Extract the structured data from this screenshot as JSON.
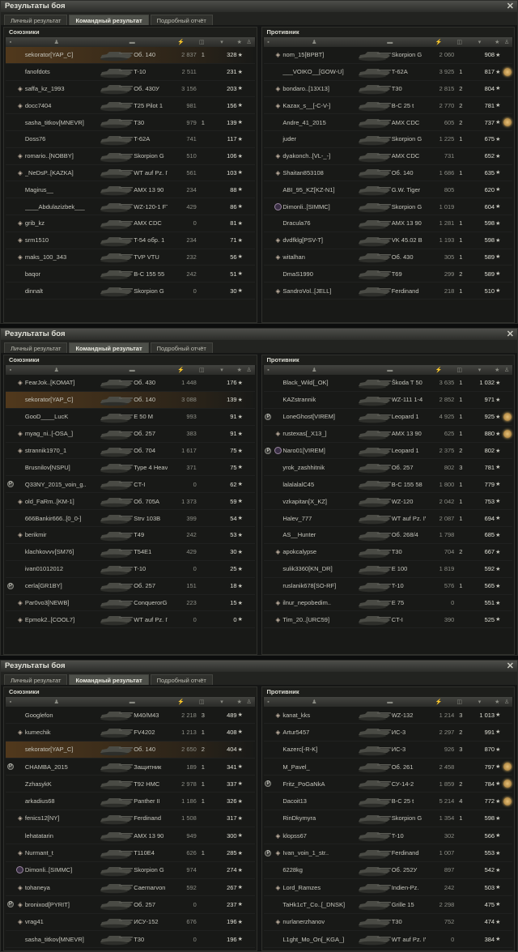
{
  "window_title": "Результаты боя",
  "close_icon": "close-icon",
  "tabs": [
    "Личный результат",
    "Командный результат",
    "Подробный отчёт"
  ],
  "active_tab": "Командный результат",
  "allies_label": "Союзники",
  "enemies_label": "Противник",
  "star": "★",
  "colors": {
    "highlight": "#8a5a26",
    "xp": "#e0e0d6",
    "damage": "#8d8e86",
    "medal": "#e6c178"
  },
  "battles": [
    {
      "allies": [
        {
          "n": "sekorator[YAP_C]",
          "t": "Об. 140",
          "d": "2 837",
          "k": "1",
          "x": "328",
          "hl": true
        },
        {
          "n": "fanofdots",
          "t": "T-10",
          "d": "2 511",
          "k": "",
          "x": "231"
        },
        {
          "n": "saffa_kz_1993",
          "t": "Об. 430У",
          "d": "3 156",
          "k": "",
          "x": "203",
          "i": "p"
        },
        {
          "n": "docc7404",
          "t": "T25 Pilot 1",
          "d": "981",
          "k": "",
          "x": "156",
          "i": "p"
        },
        {
          "n": "sasha_titkov[MNEVR]",
          "t": "T30",
          "d": "979",
          "k": "1",
          "x": "139"
        },
        {
          "n": "Doss76",
          "t": "T-62A",
          "d": "741",
          "k": "",
          "x": "117"
        },
        {
          "n": "romario..[NOBBY]",
          "t": "Skorpion G",
          "d": "510",
          "k": "",
          "x": "106",
          "i": "p"
        },
        {
          "n": "_NeDsP..[KAZKA]",
          "t": "WT auf Pz. IV",
          "d": "561",
          "k": "",
          "x": "103",
          "i": "p"
        },
        {
          "n": "Magirus__",
          "t": "AMX 13 90",
          "d": "234",
          "k": "",
          "x": "88"
        },
        {
          "n": "____Abdulazizbek___",
          "t": "WZ-120-1 FT",
          "d": "429",
          "k": "",
          "x": "86"
        },
        {
          "n": "grib_kz",
          "t": "AMX CDC",
          "d": "0",
          "k": "",
          "x": "81",
          "i": "p"
        },
        {
          "n": "srm1510",
          "t": "T-54 обр. 1",
          "d": "234",
          "k": "",
          "x": "71",
          "i": "p"
        },
        {
          "n": "maks_100_343",
          "t": "TVP VTU",
          "d": "232",
          "k": "",
          "x": "56",
          "i": "p"
        },
        {
          "n": "baqor",
          "t": "B-C 155 55",
          "d": "242",
          "k": "",
          "x": "51"
        },
        {
          "n": "dinnalt",
          "t": "Skorpion G",
          "d": "0",
          "k": "",
          "x": "30"
        }
      ],
      "enemies": [
        {
          "n": "nom_15[BPBT]",
          "t": "Skorpion G",
          "d": "2 060",
          "k": "",
          "x": "908",
          "i": "p"
        },
        {
          "n": "___VOIKO__[GOW-U]",
          "t": "T-62A",
          "d": "3 925",
          "k": "1",
          "x": "817",
          "m": true
        },
        {
          "n": "bondaro..[13X13]",
          "t": "T30",
          "d": "2 815",
          "k": "2",
          "x": "804",
          "i": "p"
        },
        {
          "n": "Kazax_s__[-C-V-]",
          "t": "B-C 25 t",
          "d": "2 770",
          "k": "2",
          "x": "781",
          "i": "p"
        },
        {
          "n": "Andre_41_2015",
          "t": "AMX CDC",
          "d": "605",
          "k": "2",
          "x": "737",
          "m": true
        },
        {
          "n": "juder",
          "t": "Skorpion G",
          "d": "1 225",
          "k": "1",
          "x": "675"
        },
        {
          "n": "dyakonch..[VL-_-]",
          "t": "AMX CDC",
          "d": "731",
          "k": "",
          "x": "652",
          "i": "p"
        },
        {
          "n": "Shaitan853108",
          "t": "Об. 140",
          "d": "1 686",
          "k": "1",
          "x": "635",
          "i": "p"
        },
        {
          "n": "ABI_95_KZ[KZ-N1]",
          "t": "G.W. Tiger",
          "d": "805",
          "k": "",
          "x": "620"
        },
        {
          "n": "Dimonli..[SIMMC]",
          "t": "Skorpion G",
          "d": "1 019",
          "k": "",
          "x": "604",
          "i": "c"
        },
        {
          "n": "Dracula76",
          "t": "AMX 13 90",
          "d": "1 281",
          "k": "1",
          "x": "598"
        },
        {
          "n": "dvdfklg[PSV-T]",
          "t": "VK 45.02 B",
          "d": "1 193",
          "k": "1",
          "x": "598",
          "i": "p"
        },
        {
          "n": "witalhan",
          "t": "Об. 430",
          "d": "305",
          "k": "1",
          "x": "589",
          "i": "p"
        },
        {
          "n": "DmaS1990",
          "t": "T69",
          "d": "299",
          "k": "2",
          "x": "589"
        },
        {
          "n": "SandroVol..[JELL]",
          "t": "Ferdinand",
          "d": "218",
          "k": "1",
          "x": "510",
          "i": "p"
        }
      ]
    },
    {
      "allies": [
        {
          "n": "FearJok..[KOMAT]",
          "t": "Об. 430",
          "d": "1 448",
          "k": "",
          "x": "176",
          "i": "p"
        },
        {
          "n": "sekorator[YAP_C]",
          "t": "Об. 140",
          "d": "3 088",
          "k": "",
          "x": "139",
          "hl": true
        },
        {
          "n": "GooD____LucK",
          "t": "E 50 M",
          "d": "993",
          "k": "",
          "x": "91"
        },
        {
          "n": "myag_ni..[-OSA_]",
          "t": "Об. 257",
          "d": "383",
          "k": "",
          "x": "91",
          "i": "pp"
        },
        {
          "n": "strannik1970_1",
          "t": "Об. 704",
          "d": "1 617",
          "k": "",
          "x": "75",
          "i": "p"
        },
        {
          "n": "Brusnilov[NSPU]",
          "t": "Type 4 Heavy",
          "d": "371",
          "k": "",
          "x": "75"
        },
        {
          "n": "Q33NY_2015_voin_g..",
          "t": "CT-I",
          "d": "0",
          "k": "",
          "x": "62",
          "i": "s"
        },
        {
          "n": "old_FaRm..[KM-1]",
          "t": "Об. 705A",
          "d": "1 373",
          "k": "",
          "x": "59",
          "i": "p"
        },
        {
          "n": "666Bankir666..[0_0-]",
          "t": "Strv 103B",
          "d": "399",
          "k": "",
          "x": "54"
        },
        {
          "n": "berikmir",
          "t": "T49",
          "d": "242",
          "k": "",
          "x": "53",
          "i": "p"
        },
        {
          "n": "klachkovvv[SM76]",
          "t": "T54E1",
          "d": "429",
          "k": "",
          "x": "30"
        },
        {
          "n": "ivan01012012",
          "t": "T-10",
          "d": "0",
          "k": "",
          "x": "25"
        },
        {
          "n": "cerla[GR1BY]",
          "t": "Об. 257",
          "d": "151",
          "k": "",
          "x": "18",
          "i": "s"
        },
        {
          "n": "Par0vo3[NEWB]",
          "t": "ConquerorGC",
          "d": "223",
          "k": "",
          "x": "15",
          "i": "p"
        },
        {
          "n": "Epmok2..[COOL7]",
          "t": "WT auf Pz. IV",
          "d": "0",
          "k": "",
          "x": "0",
          "i": "p"
        }
      ],
      "enemies": [
        {
          "n": "Black_Wild[_OK]",
          "t": "Škoda T 50",
          "d": "3 635",
          "k": "1",
          "x": "1 032"
        },
        {
          "n": "KAZstrannik",
          "t": "WZ-111 1-4",
          "d": "2 852",
          "k": "1",
          "x": "971"
        },
        {
          "n": "LoneGhost[VIREM]",
          "t": "Leopard 1",
          "d": "4 925",
          "k": "1",
          "x": "925",
          "i": "s",
          "m": true
        },
        {
          "n": "rustexas[_X13_]",
          "t": "AMX 13 90",
          "d": "625",
          "k": "1",
          "x": "880",
          "i": "p",
          "m": true
        },
        {
          "n": "Naro01[VIREM]",
          "t": "Leopard 1",
          "d": "2 375",
          "k": "2",
          "x": "802",
          "i": "sc"
        },
        {
          "n": "yrok_zashhitnik",
          "t": "Об. 257",
          "d": "802",
          "k": "3",
          "x": "781"
        },
        {
          "n": "lalalalalC45",
          "t": "B-C 155 58",
          "d": "1 800",
          "k": "1",
          "x": "779"
        },
        {
          "n": "vzkapitan[X_KZ]",
          "t": "WZ-120",
          "d": "2 042",
          "k": "1",
          "x": "753"
        },
        {
          "n": "Halev_777",
          "t": "WT auf Pz. IV",
          "d": "2 087",
          "k": "1",
          "x": "694"
        },
        {
          "n": "AS__Hunter",
          "t": "Об. 268/4",
          "d": "1 798",
          "k": "",
          "x": "685"
        },
        {
          "n": "apokcalypse",
          "t": "T30",
          "d": "704",
          "k": "2",
          "x": "667",
          "i": "p"
        },
        {
          "n": "sulik3360[KN_DR]",
          "t": "E 100",
          "d": "1 819",
          "k": "",
          "x": "592"
        },
        {
          "n": "ruslanik678[SO-RF]",
          "t": "T-10",
          "d": "576",
          "k": "1",
          "x": "565"
        },
        {
          "n": "ilnur_nepobedim..",
          "t": "E 75",
          "d": "0",
          "k": "",
          "x": "551",
          "i": "p"
        },
        {
          "n": "Tim_20..[URC59]",
          "t": "CT-I",
          "d": "390",
          "k": "",
          "x": "525",
          "i": "p"
        }
      ]
    },
    {
      "allies": [
        {
          "n": "Googlefon",
          "t": "M40/M43",
          "d": "2 218",
          "k": "3",
          "x": "489"
        },
        {
          "n": "kumechik",
          "t": "FV4202",
          "d": "1 213",
          "k": "1",
          "x": "408",
          "i": "p"
        },
        {
          "n": "sekorator[YAP_C]",
          "t": "Об. 140",
          "d": "2 650",
          "k": "2",
          "x": "404",
          "hl": true
        },
        {
          "n": "CHAMBA_2015",
          "t": "Защитник",
          "d": "189",
          "k": "1",
          "x": "341",
          "i": "s"
        },
        {
          "n": "ZzhasykK",
          "t": "T92 HMC",
          "d": "2 978",
          "k": "1",
          "x": "337"
        },
        {
          "n": "arkadius68",
          "t": "Panther II",
          "d": "1 186",
          "k": "1",
          "x": "326"
        },
        {
          "n": "fenics12[NY]",
          "t": "Ferdinand",
          "d": "1 508",
          "k": "",
          "x": "317",
          "i": "p"
        },
        {
          "n": "lehatatarin",
          "t": "AMX 13 90",
          "d": "949",
          "k": "",
          "x": "300"
        },
        {
          "n": "Nurmant_t",
          "t": "T110E4",
          "d": "626",
          "k": "1",
          "x": "285",
          "i": "p"
        },
        {
          "n": "Dimonli..[SIMMC]",
          "t": "Skorpion G",
          "d": "974",
          "k": "",
          "x": "274",
          "i": "c"
        },
        {
          "n": "tohaneya",
          "t": "Caernarvon",
          "d": "592",
          "k": "",
          "x": "267",
          "i": "p"
        },
        {
          "n": "bronixod[PYRIT]",
          "t": "Об. 257",
          "d": "0",
          "k": "",
          "x": "237",
          "i": "sp"
        },
        {
          "n": "vrag41",
          "t": "ИСУ-152",
          "d": "676",
          "k": "",
          "x": "196",
          "i": "p"
        },
        {
          "n": "sasha_titkov[MNEVR]",
          "t": "T30",
          "d": "0",
          "k": "",
          "x": "196"
        }
      ],
      "enemies": [
        {
          "n": "kanat_kks",
          "t": "WZ-132",
          "d": "1 214",
          "k": "3",
          "x": "1 013",
          "i": "p"
        },
        {
          "n": "Artur5457",
          "t": "ИС-3",
          "d": "2 297",
          "k": "2",
          "x": "991",
          "i": "p"
        },
        {
          "n": "Kazerc[-R-K]",
          "t": "ИС-3",
          "d": "926",
          "k": "3",
          "x": "870"
        },
        {
          "n": "M_Pavel_",
          "t": "Об. 261",
          "d": "2 458",
          "k": "",
          "x": "797",
          "m": true
        },
        {
          "n": "Fritz_PoGaNkA",
          "t": "СУ-14-2",
          "d": "1 859",
          "k": "2",
          "x": "784",
          "i": "s",
          "m": true
        },
        {
          "n": "Dacoit13",
          "t": "B-C 25 t",
          "d": "5 214",
          "k": "4",
          "x": "772",
          "m": true
        },
        {
          "n": "RinDkymyra",
          "t": "Skorpion G",
          "d": "1 354",
          "k": "1",
          "x": "598"
        },
        {
          "n": "klopss67",
          "t": "T-10",
          "d": "302",
          "k": "",
          "x": "566",
          "i": "p"
        },
        {
          "n": "Ivan_voin_1_str..",
          "t": "Ferdinand",
          "d": "1 007",
          "k": "",
          "x": "553",
          "i": "sp"
        },
        {
          "n": "6228kg",
          "t": "Об. 252У",
          "d": "897",
          "k": "",
          "x": "542"
        },
        {
          "n": "Lord_Ramzes",
          "t": "Indien-Pz.",
          "d": "242",
          "k": "",
          "x": "503",
          "i": "p"
        },
        {
          "n": "TaHk1cT_Co..[_DNSK]",
          "t": "Grille 15",
          "d": "2 298",
          "k": "",
          "x": "475"
        },
        {
          "n": "nurlanerzhanov",
          "t": "T30",
          "d": "752",
          "k": "",
          "x": "474",
          "i": "p"
        },
        {
          "n": "L1ght_Mo_On[_KGA_]",
          "t": "WT auf Pz. IV",
          "d": "0",
          "k": "",
          "x": "384"
        }
      ]
    }
  ]
}
